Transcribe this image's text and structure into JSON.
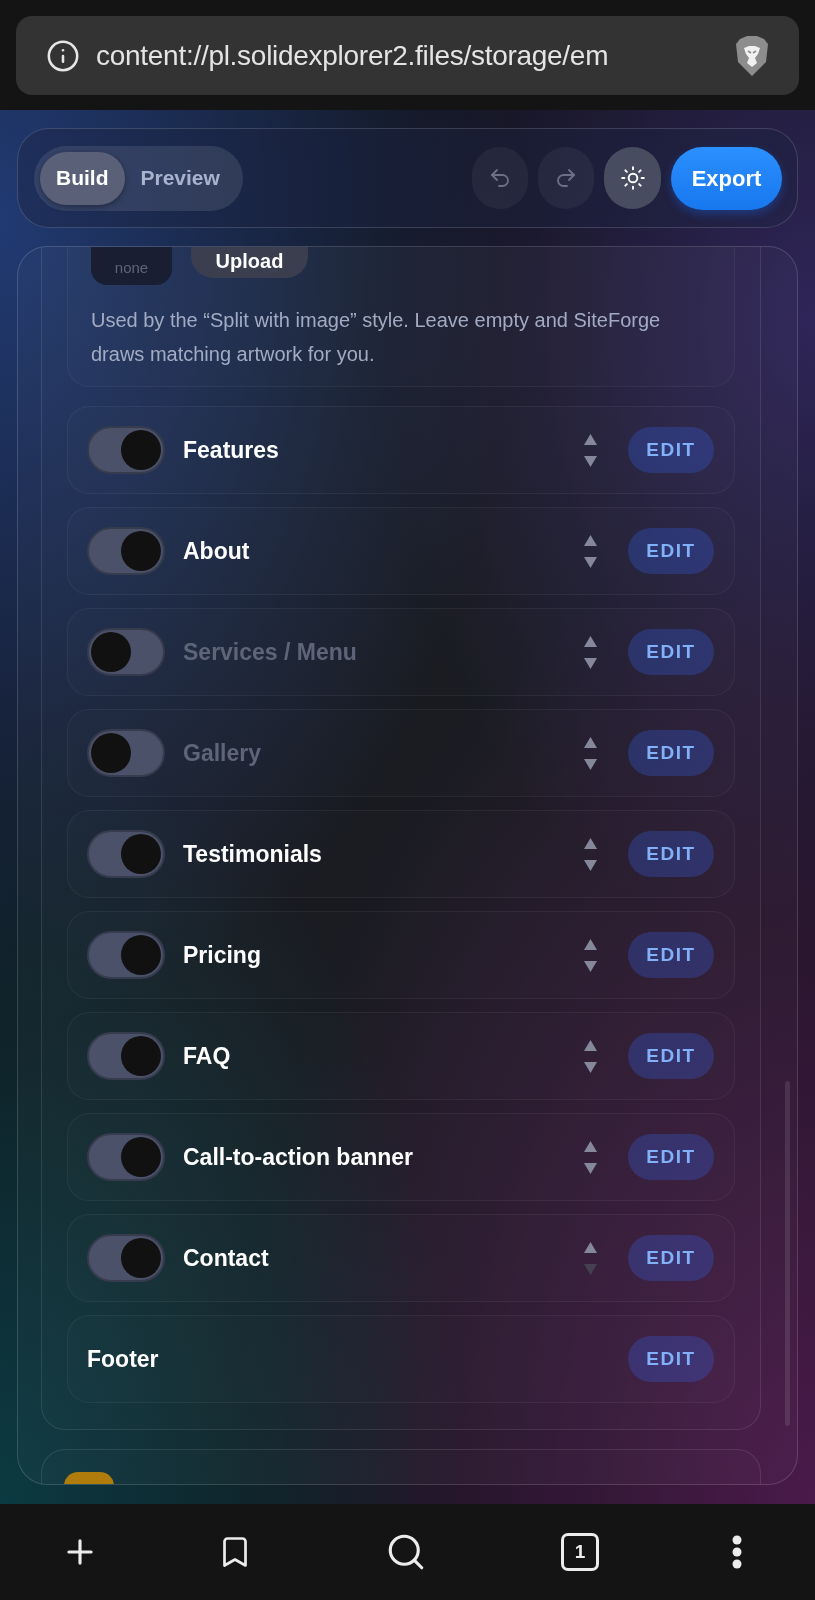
{
  "browser": {
    "url": "content://pl.solidexplorer2.files/storage/em",
    "tab_count": "1"
  },
  "toolbar": {
    "modes": [
      {
        "label": "Build",
        "selected": true
      },
      {
        "label": "Preview",
        "selected": false
      }
    ],
    "undo": {
      "disabled": true
    },
    "redo": {
      "disabled": true
    },
    "export_button": "Export"
  },
  "image_field": {
    "placeholder": "none",
    "upload_button": "Upload",
    "hint": "Used by the “Split with image” style. Leave empty and SiteForge draws matching artwork for you."
  },
  "sections": [
    {
      "kind": "toggle",
      "label": "Features",
      "on": true,
      "move_down_disabled": false,
      "edit_button": "EDIT"
    },
    {
      "kind": "toggle",
      "label": "About",
      "on": true,
      "move_down_disabled": false,
      "edit_button": "EDIT"
    },
    {
      "kind": "toggle",
      "label": "Services / Menu",
      "on": false,
      "move_down_disabled": false,
      "edit_button": "EDIT"
    },
    {
      "kind": "toggle",
      "label": "Gallery",
      "on": false,
      "move_down_disabled": false,
      "edit_button": "EDIT"
    },
    {
      "kind": "toggle",
      "label": "Testimonials",
      "on": true,
      "move_down_disabled": false,
      "edit_button": "EDIT"
    },
    {
      "kind": "toggle",
      "label": "Pricing",
      "on": true,
      "move_down_disabled": false,
      "edit_button": "EDIT"
    },
    {
      "kind": "toggle",
      "label": "FAQ",
      "on": true,
      "move_down_disabled": false,
      "edit_button": "EDIT"
    },
    {
      "kind": "toggle",
      "label": "Call-to-action banner",
      "on": true,
      "move_down_disabled": false,
      "edit_button": "EDIT"
    },
    {
      "kind": "toggle",
      "label": "Contact",
      "on": true,
      "move_down_disabled": true,
      "edit_button": "EDIT"
    },
    {
      "kind": "fixed",
      "label": "Footer",
      "edit_button": "EDIT"
    }
  ]
}
